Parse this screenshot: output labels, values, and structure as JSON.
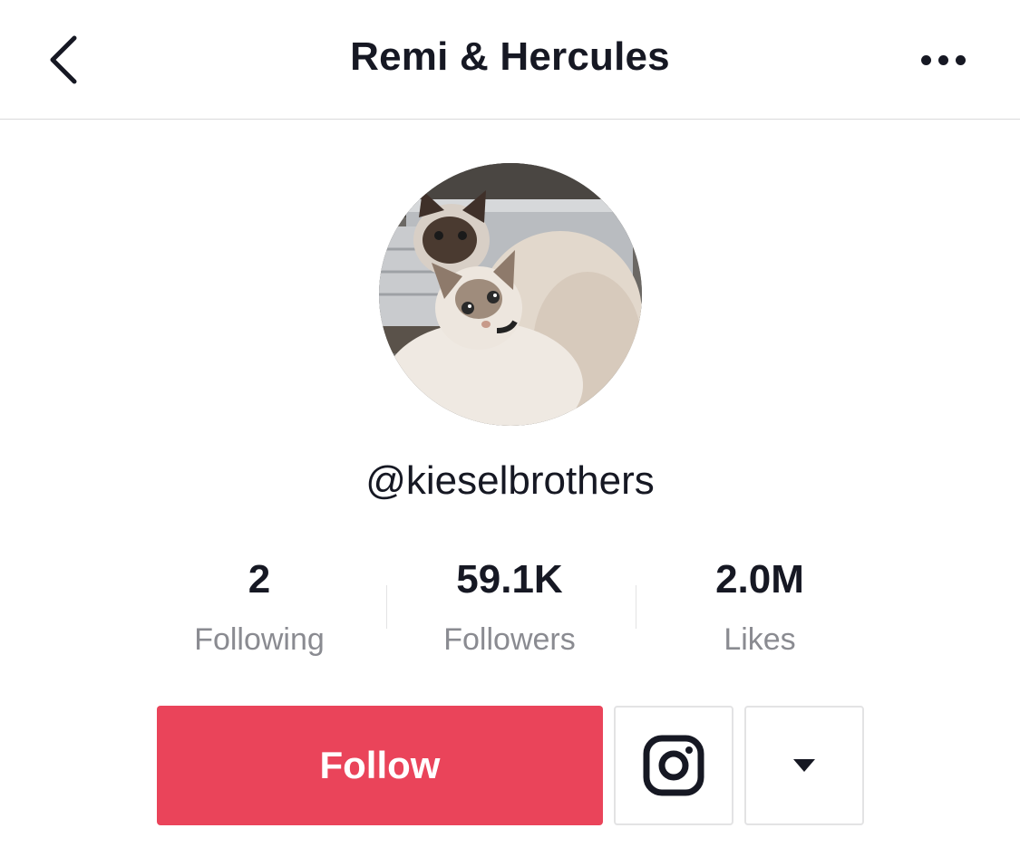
{
  "header": {
    "title": "Remi & Hercules",
    "back_icon": "chevron-left-icon",
    "more_icon": "more-dots-icon"
  },
  "profile": {
    "avatar_icon": "avatar-photo",
    "username": "@kieselbrothers"
  },
  "stats": [
    {
      "value": "2",
      "label": "Following"
    },
    {
      "value": "59.1K",
      "label": "Followers"
    },
    {
      "value": "2.0M",
      "label": "Likes"
    }
  ],
  "actions": {
    "follow_label": "Follow",
    "instagram_icon": "instagram-icon",
    "dropdown_icon": "caret-down-icon"
  },
  "colors": {
    "accent": "#ea445a",
    "text_primary": "#161823",
    "text_secondary": "#8a8b91",
    "divider": "#e3e3e4"
  }
}
